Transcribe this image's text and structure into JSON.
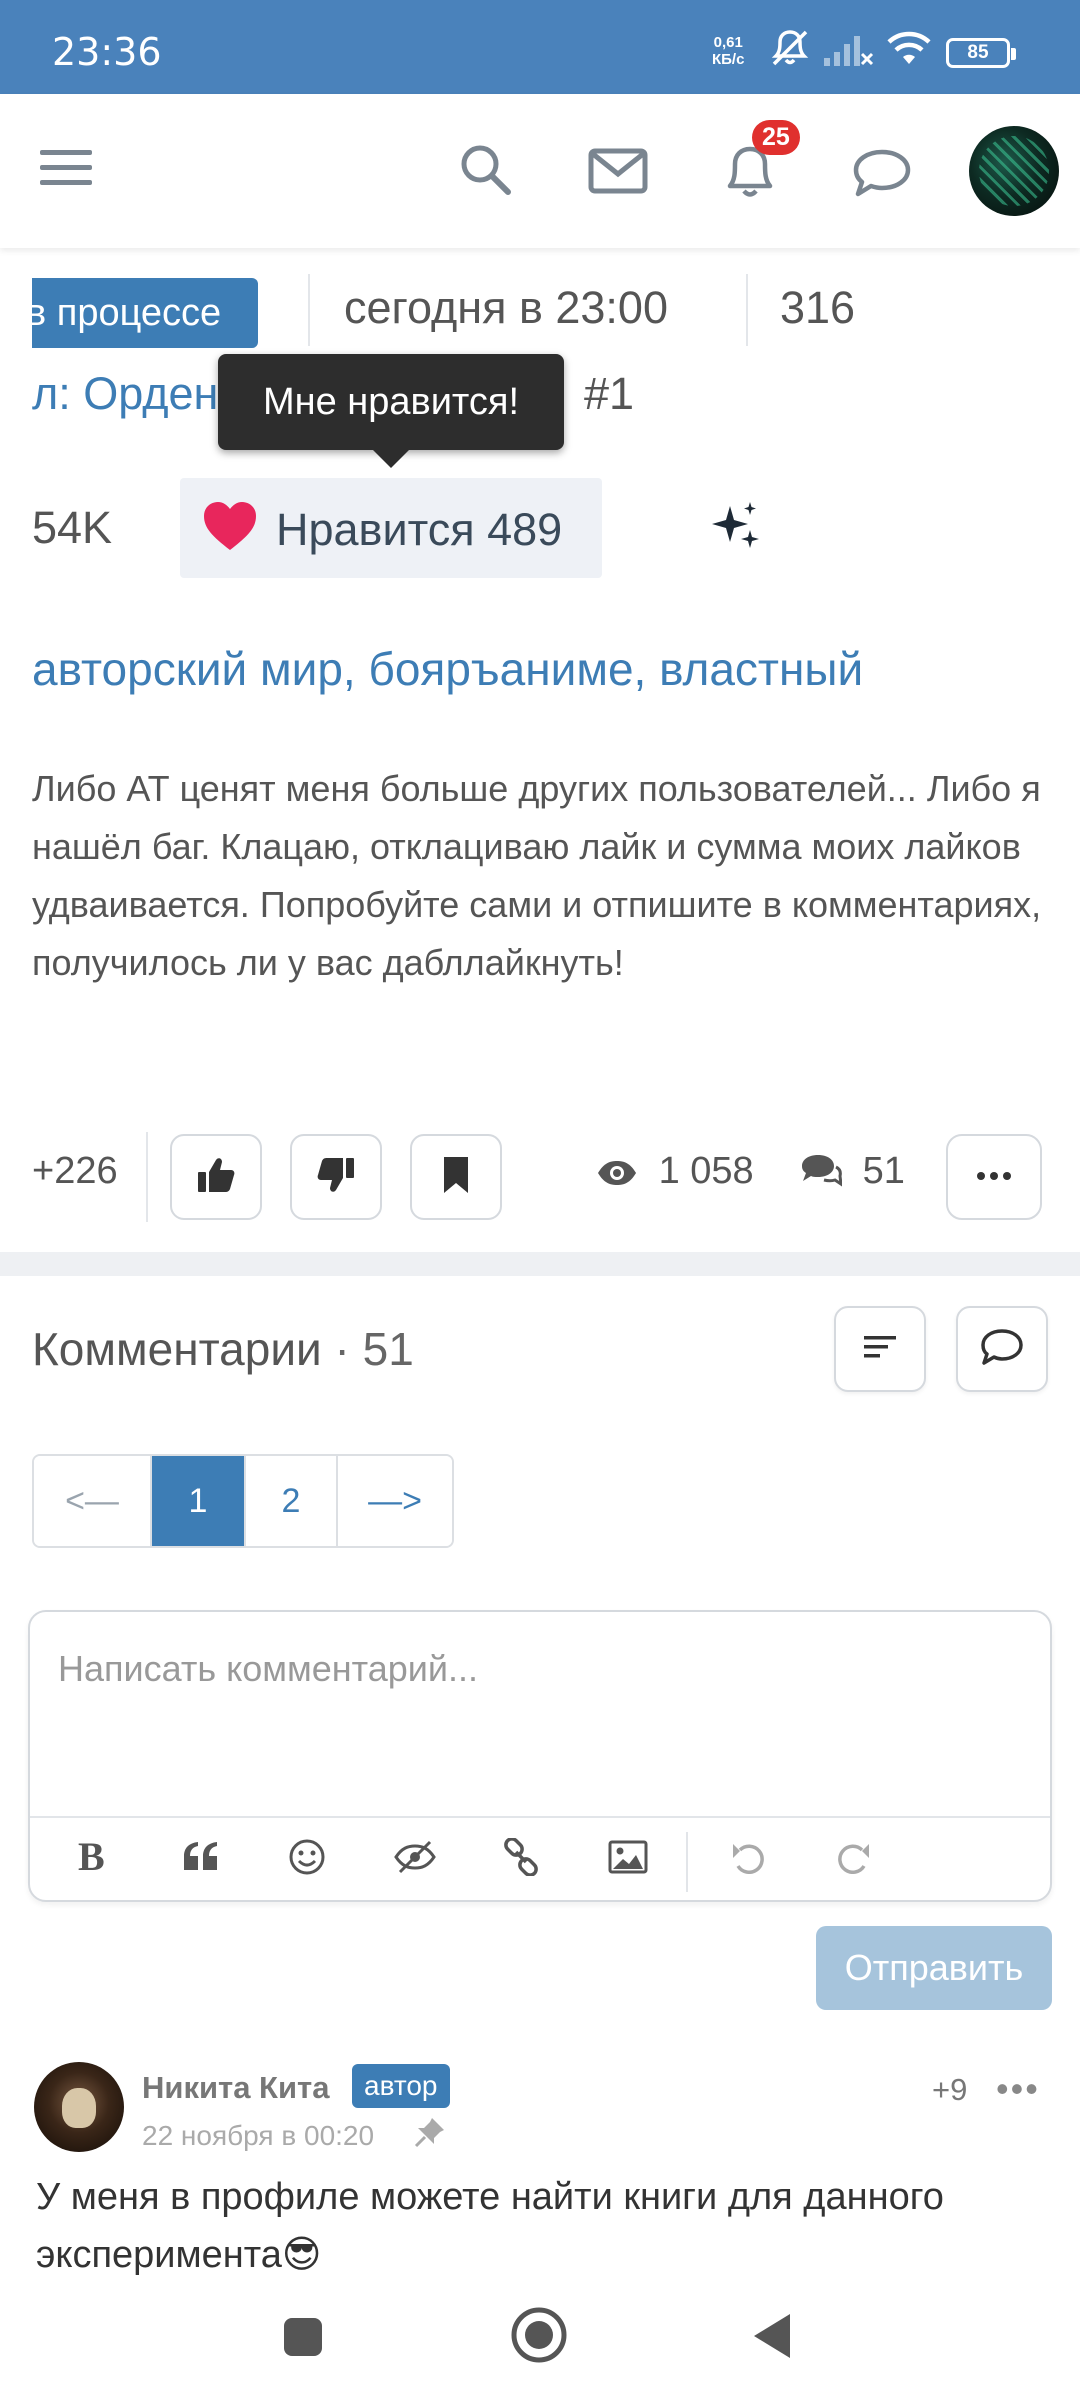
{
  "status_bar": {
    "time": "23:36",
    "net_speed_value": "0,61",
    "net_speed_unit": "КБ/с",
    "battery": "85"
  },
  "header": {
    "notifications_badge": "25",
    "icons": [
      "menu-icon",
      "search-icon",
      "mail-icon",
      "bell-icon",
      "chat-icon"
    ]
  },
  "book": {
    "status_label": "в процессе",
    "updated": "сегодня в 23:00",
    "chapters": "316",
    "series_prefix": "л:",
    "series_name": "Орден",
    "series_number": "#1",
    "reads": "54K",
    "like_label": "Нравится",
    "like_count": "489",
    "tooltip": "Мне нравится!",
    "tags": "авторский мир, бояръаниме, властный"
  },
  "post": {
    "text": "Либо АТ ценят меня больше других пользователей... Либо я нашёл баг. Клацаю, отклациваю лайк и сумма моих лайков удваивается. Попробуйте сами и отпишите в комментариях, получилось ли у вас дабллайкнуть!",
    "score": "+226",
    "views": "1 058",
    "comments": "51"
  },
  "comments": {
    "title": "Комментарии",
    "count": "· 51",
    "pager": [
      "<—",
      "1",
      "2",
      "—>"
    ],
    "editor_placeholder": "Написать комментарий...",
    "send_label": "Отправить",
    "items": [
      {
        "author": "Никита Кита",
        "badge": "автор",
        "date": "22 ноября в 00:20",
        "score": "+9",
        "more": "•••",
        "text": "У меня в профиле можете найти книги для данного эксперимента😎"
      }
    ]
  },
  "colors": {
    "status_bar": "#4a82bb",
    "accent": "#3d7db5",
    "heart": "#e8265c",
    "send_disabled": "#a6c4dc"
  }
}
